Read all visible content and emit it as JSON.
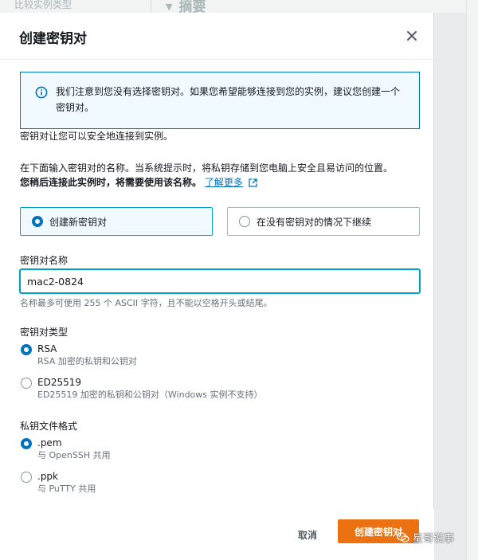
{
  "background": {
    "left_text": "比较实例类型",
    "right_title": "摘要"
  },
  "modal": {
    "title": "创建密钥对"
  },
  "info": {
    "text": "我们注意到您没有选择密钥对。如果您希望能够连接到您的实例，建议您创建一个密钥对。"
  },
  "intro": {
    "line1": "密钥对让您可以安全地连接到实例。",
    "line2": "在下面输入密钥对的名称。当系统提示时，将私钥存储到您电脑上安全且易访问的位置。",
    "line3_bold": "您稍后连接此实例时，将需要使用该名称。",
    "learn_more": "了解更多"
  },
  "tiles": {
    "create": "创建新密钥对",
    "proceed_without": "在没有密钥对的情况下继续"
  },
  "name_field": {
    "label": "密钥对名称",
    "value": "mac2-0824",
    "hint": "名称最多可使用 255 个 ASCII 字符，且不能以空格开头或结尾。"
  },
  "key_type": {
    "label": "密钥对类型",
    "options": [
      {
        "title": "RSA",
        "desc": "RSA 加密的私钥和公钥对",
        "selected": true
      },
      {
        "title": "ED25519",
        "desc": "ED25519 加密的私钥和公钥对（Windows 实例不支持）",
        "selected": false
      }
    ]
  },
  "file_format": {
    "label": "私钥文件格式",
    "options": [
      {
        "title": ".pem",
        "desc": "与 OpenSSH 共用",
        "selected": true
      },
      {
        "title": ".ppk",
        "desc": "与 PuTTY 共用",
        "selected": false
      }
    ]
  },
  "footer": {
    "cancel": "取消",
    "create": "创建密钥对"
  },
  "watermark": {
    "text": "星哥说事"
  },
  "colors": {
    "accent": "#0073bb",
    "primary_button": "#ec7211",
    "info_bg": "#f1faff"
  }
}
